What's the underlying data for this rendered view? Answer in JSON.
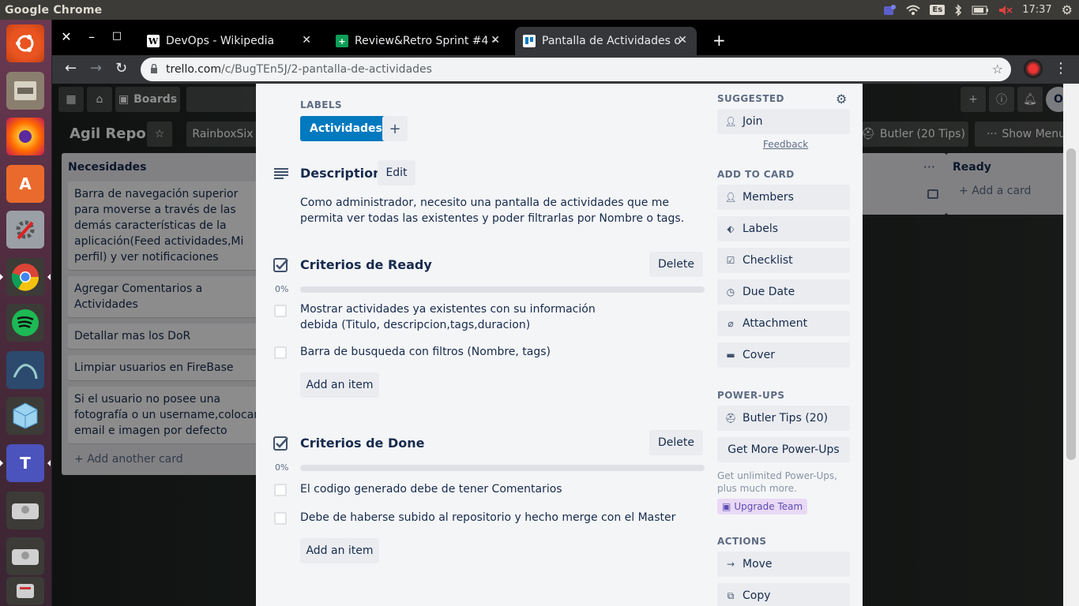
{
  "os": {
    "app_name": "Google Chrome",
    "keyboard_layout": "Es",
    "clock": "17:37",
    "launcher_items": [
      "ubuntu-logo-icon",
      "files-icon",
      "firefox-icon",
      "software-center-icon",
      "settings-tool-icon",
      "chrome-icon",
      "spotify-icon",
      "mysql-workbench-icon",
      "virtualbox-icon",
      "teams-icon",
      "drive-icon",
      "drive-icon",
      "usb-drive-icon"
    ]
  },
  "browser": {
    "tabs": [
      {
        "title": "DevOps - Wikipedia",
        "favicon": "W"
      },
      {
        "title": "Review&Retro Sprint #4 -",
        "favicon": "+"
      },
      {
        "title": "Pantalla de Actividades o",
        "favicon": "trello"
      }
    ],
    "url_domain": "trello.com",
    "url_path": "/c/BugTEn5J/2-pantalla-de-actividades"
  },
  "board": {
    "boards_label": "Boards",
    "title": "Agil Repo",
    "team_label": "RainboxSix",
    "butler_label": "Butler (20 Tips)",
    "show_menu_label": "Show Menu",
    "list_necesidades": {
      "title": "Necesidades",
      "cards": [
        "Barra de navegación superior para moverse a través de las demás características de la aplicación(Feed actividades,Mi perfil) y ver notificaciones",
        "Agregar Comentarios a Actividades",
        "Detallar mas los DoR",
        "Limpiar usuarios en FireBase",
        "Si el usuario no posee una fotografía o un username,colocar email e imagen por defecto"
      ],
      "add_label": "Add another card"
    },
    "list_ready": {
      "title": "Ready",
      "add_label": "Add a card"
    }
  },
  "card_modal": {
    "labels_heading": "LABELS",
    "label_chip": "Actividades",
    "description_title": "Description",
    "edit_label": "Edit",
    "description_text": "Como administrador, necesito una pantalla de actividades que me permita ver todas las existentes y poder filtrarlas por Nombre o tags.",
    "checklists": [
      {
        "title": "Criterios de Ready",
        "delete_label": "Delete",
        "progress": "0%",
        "items": [
          "Mostrar actividades ya existentes con su información debida (Titulo, descripcion,tags,duracion)",
          "Barra de busqueda con filtros (Nombre, tags)"
        ],
        "add_item_label": "Add an item"
      },
      {
        "title": "Criterios de Done",
        "delete_label": "Delete",
        "progress": "0%",
        "items": [
          "El codigo generado debe de tener Comentarios",
          "Debe de haberse subido al repositorio y hecho merge con el Master"
        ],
        "add_item_label": "Add an item"
      }
    ],
    "sidebar": {
      "suggested_heading": "SUGGESTED",
      "join_label": "Join",
      "feedback_label": "Feedback",
      "add_to_card_heading": "ADD TO CARD",
      "add_to_card": [
        "Members",
        "Labels",
        "Checklist",
        "Due Date",
        "Attachment",
        "Cover"
      ],
      "powerups_heading": "POWER-UPS",
      "butler_tips": "Butler Tips (20)",
      "get_more": "Get More Power-Ups",
      "unlimited_text": "Get unlimited Power-Ups, plus much more.",
      "upgrade_team": "Upgrade Team",
      "actions_heading": "ACTIONS",
      "actions": [
        "Move",
        "Copy"
      ]
    }
  },
  "colors": {
    "label_blue": "#0079bf",
    "upgrade_pink": "#e9d9f5"
  }
}
